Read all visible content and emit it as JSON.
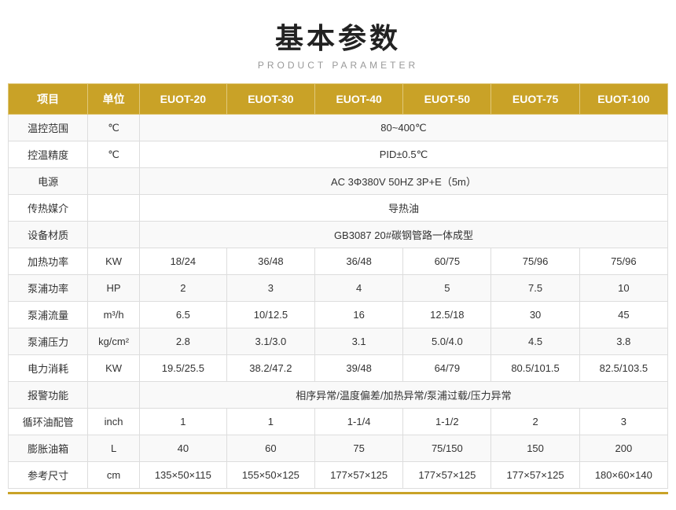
{
  "title": {
    "cn": "基本参数",
    "en": "PRODUCT PARAMETER"
  },
  "table": {
    "headers": [
      "项目",
      "单位",
      "EUOT-20",
      "EUOT-30",
      "EUOT-40",
      "EUOT-50",
      "EUOT-75",
      "EUOT-100"
    ],
    "rows": [
      {
        "item": "温控范围",
        "unit": "℃",
        "span": true,
        "spanValue": "80~400℃",
        "values": []
      },
      {
        "item": "控温精度",
        "unit": "℃",
        "span": true,
        "spanValue": "PID±0.5℃",
        "values": []
      },
      {
        "item": "电源",
        "unit": "",
        "span": true,
        "spanValue": "AC 3Φ380V 50HZ  3P+E（5m）",
        "values": []
      },
      {
        "item": "传热媒介",
        "unit": "",
        "span": true,
        "spanValue": "导热油",
        "values": []
      },
      {
        "item": "设备材质",
        "unit": "",
        "span": true,
        "spanValue": "GB3087    20#碳钢管路一体成型",
        "values": []
      },
      {
        "item": "加热功率",
        "unit": "KW",
        "span": false,
        "spanValue": "",
        "values": [
          "18/24",
          "36/48",
          "36/48",
          "60/75",
          "75/96",
          "75/96"
        ]
      },
      {
        "item": "泵浦功率",
        "unit": "HP",
        "span": false,
        "spanValue": "",
        "values": [
          "2",
          "3",
          "4",
          "5",
          "7.5",
          "10"
        ]
      },
      {
        "item": "泵浦流量",
        "unit": "m³/h",
        "span": false,
        "spanValue": "",
        "values": [
          "6.5",
          "10/12.5",
          "16",
          "12.5/18",
          "30",
          "45"
        ]
      },
      {
        "item": "泵浦压力",
        "unit": "kg/cm²",
        "span": false,
        "spanValue": "",
        "values": [
          "2.8",
          "3.1/3.0",
          "3.1",
          "5.0/4.0",
          "4.5",
          "3.8"
        ]
      },
      {
        "item": "电力消耗",
        "unit": "KW",
        "span": false,
        "spanValue": "",
        "values": [
          "19.5/25.5",
          "38.2/47.2",
          "39/48",
          "64/79",
          "80.5/101.5",
          "82.5/103.5"
        ]
      },
      {
        "item": "报警功能",
        "unit": "",
        "span": true,
        "spanValue": "相序异常/温度偏差/加热异常/泵浦过载/压力异常",
        "values": []
      },
      {
        "item": "循环油配管",
        "unit": "inch",
        "span": false,
        "spanValue": "",
        "values": [
          "1",
          "1",
          "1-1/4",
          "1-1/2",
          "2",
          "3"
        ]
      },
      {
        "item": "膨胀油箱",
        "unit": "L",
        "span": false,
        "spanValue": "",
        "values": [
          "40",
          "60",
          "75",
          "75/150",
          "150",
          "200"
        ]
      },
      {
        "item": "参考尺寸",
        "unit": "cm",
        "span": false,
        "spanValue": "",
        "values": [
          "135×50×115",
          "155×50×125",
          "177×57×125",
          "177×57×125",
          "177×57×125",
          "180×60×140"
        ]
      }
    ]
  }
}
